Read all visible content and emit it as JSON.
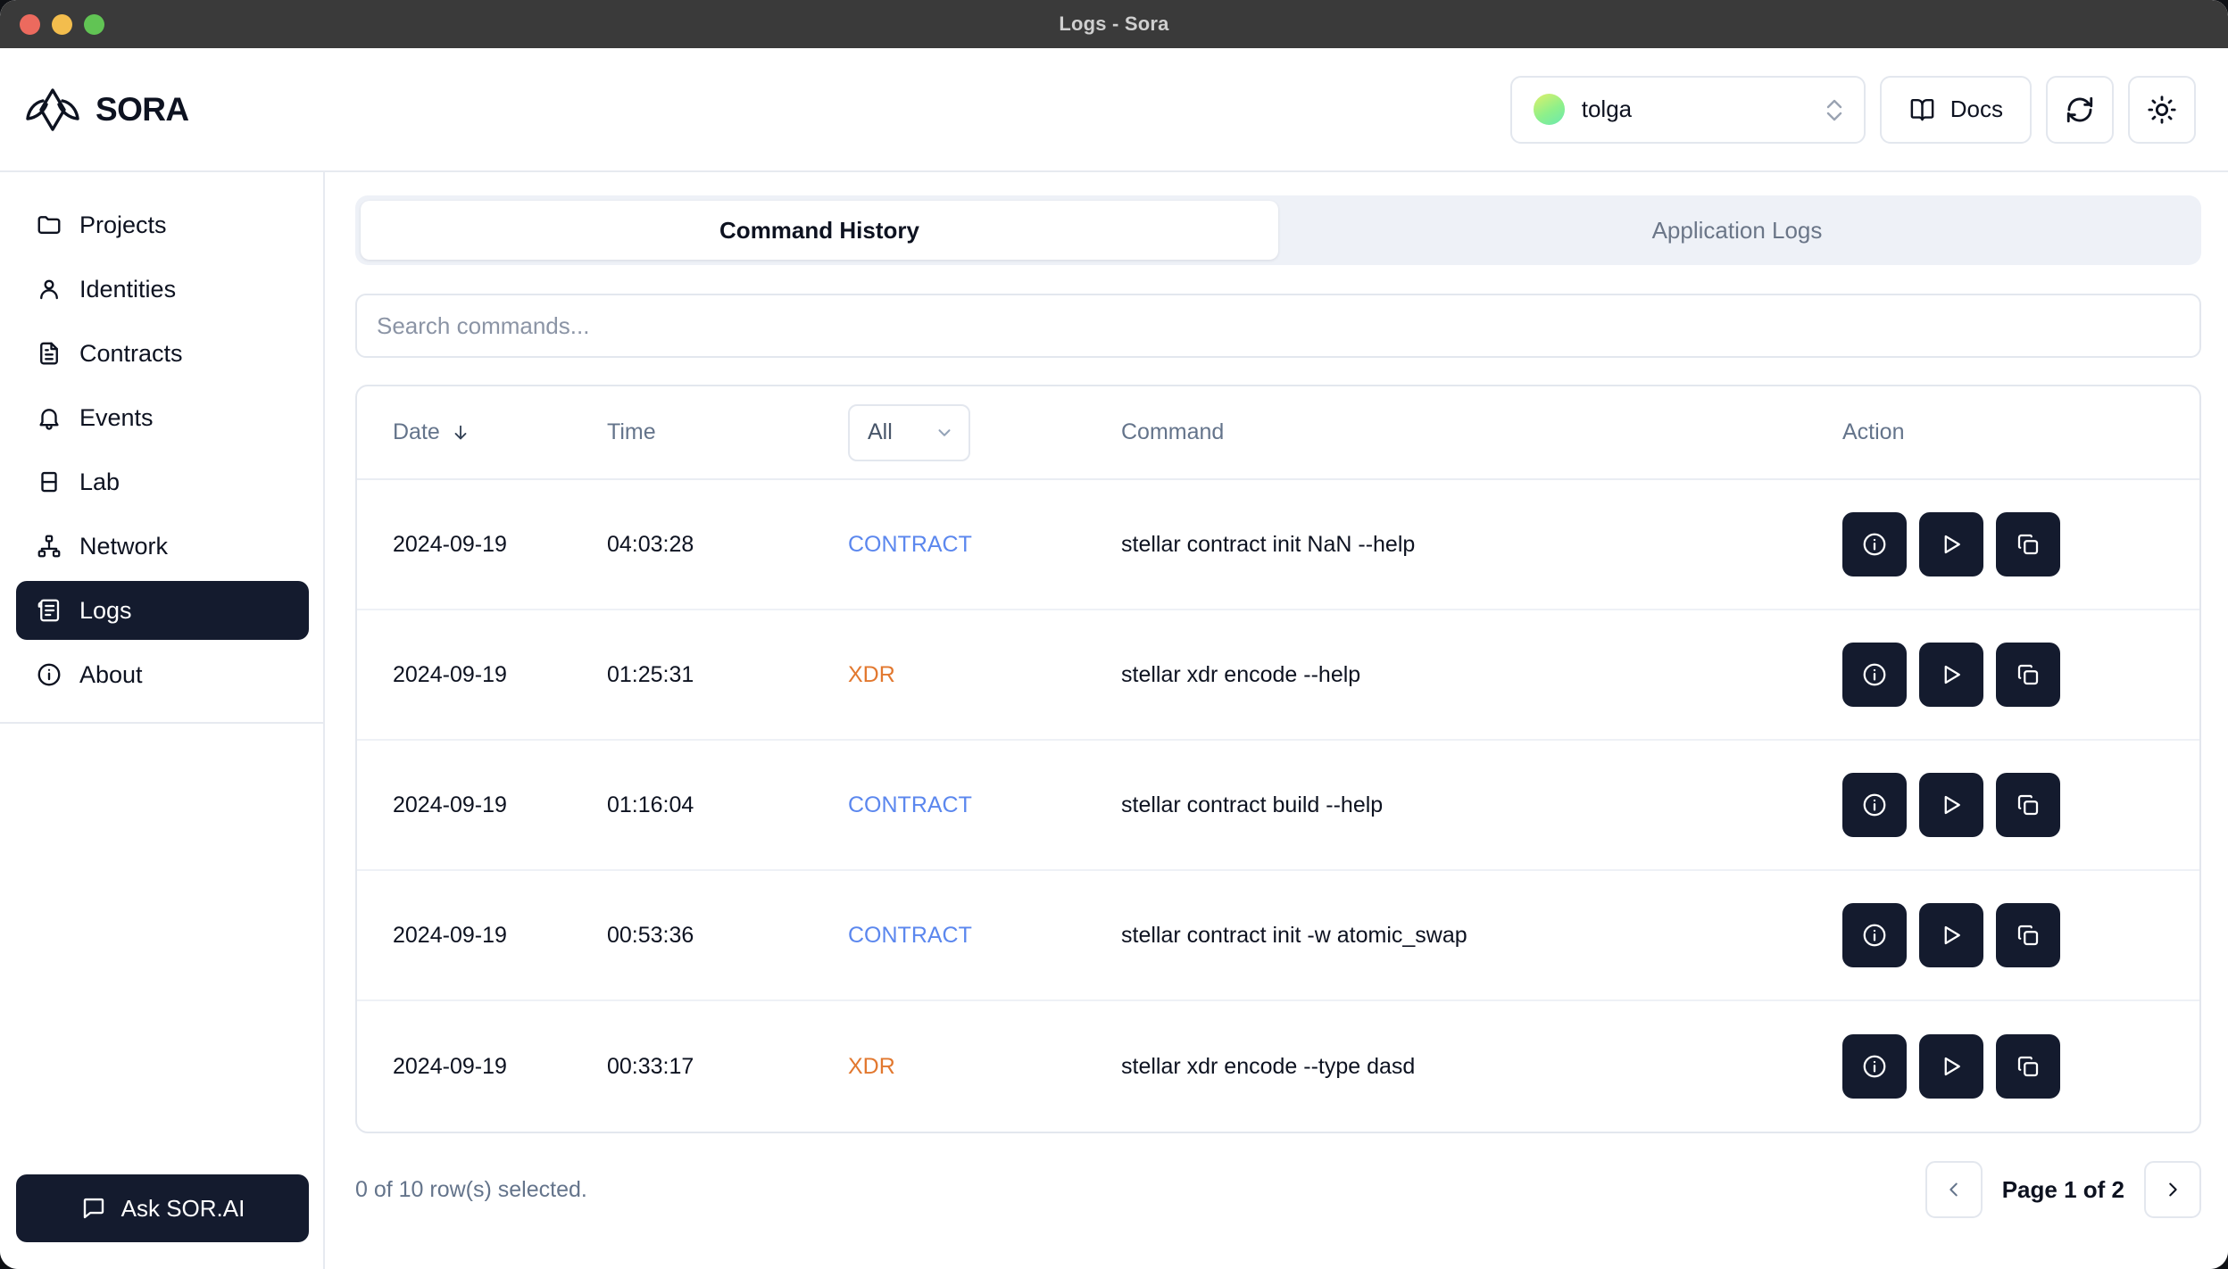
{
  "window": {
    "title": "Logs - Sora",
    "traffic_lights": [
      "close",
      "minimize",
      "zoom"
    ]
  },
  "header": {
    "brand": "SORA",
    "profile": {
      "name": "tolga",
      "icon": "avatar",
      "chevron": "chevron-up-down-icon"
    },
    "docs_label": "Docs",
    "docs_icon": "book-icon",
    "refresh_icon": "refresh-icon",
    "theme_icon": "sun-icon"
  },
  "sidebar": {
    "items": [
      {
        "label": "Projects",
        "icon": "folder-icon",
        "active": false
      },
      {
        "label": "Identities",
        "icon": "user-icon",
        "active": false
      },
      {
        "label": "Contracts",
        "icon": "document-icon",
        "active": false
      },
      {
        "label": "Events",
        "icon": "bell-icon",
        "active": false
      },
      {
        "label": "Lab",
        "icon": "beaker-icon",
        "active": false
      },
      {
        "label": "Network",
        "icon": "network-icon",
        "active": false
      },
      {
        "label": "Logs",
        "icon": "scroll-icon",
        "active": true
      },
      {
        "label": "About",
        "icon": "info-icon",
        "active": false
      }
    ],
    "ask_button": {
      "label": "Ask SOR.AI",
      "icon": "chat-icon"
    }
  },
  "main": {
    "tabs": [
      {
        "label": "Command History",
        "active": true
      },
      {
        "label": "Application Logs",
        "active": false
      }
    ],
    "search": {
      "value": "",
      "placeholder": "Search commands..."
    },
    "table": {
      "columns": {
        "date": "Date",
        "date_sort_icon": "arrow-down-icon",
        "time": "Time",
        "type_filter": {
          "value": "All",
          "icon": "chevron-down-icon"
        },
        "command": "Command",
        "action": "Action"
      },
      "rows": [
        {
          "date": "2024-09-19",
          "time": "04:03:28",
          "type": "CONTRACT",
          "type_class": "contract",
          "command": "stellar contract init NaN --help"
        },
        {
          "date": "2024-09-19",
          "time": "01:25:31",
          "type": "XDR",
          "type_class": "xdr",
          "command": "stellar xdr encode --help"
        },
        {
          "date": "2024-09-19",
          "time": "01:16:04",
          "type": "CONTRACT",
          "type_class": "contract",
          "command": "stellar contract build --help"
        },
        {
          "date": "2024-09-19",
          "time": "00:53:36",
          "type": "CONTRACT",
          "type_class": "contract",
          "command": "stellar contract init -w atomic_swap"
        },
        {
          "date": "2024-09-19",
          "time": "00:33:17",
          "type": "XDR",
          "type_class": "xdr",
          "command": "stellar xdr encode --type dasd"
        }
      ],
      "row_actions": [
        {
          "name": "details-button",
          "icon": "info-circle-icon"
        },
        {
          "name": "run-button",
          "icon": "play-icon"
        },
        {
          "name": "copy-button",
          "icon": "copy-icon"
        }
      ]
    },
    "footer": {
      "rows_selected": "0 of 10 row(s) selected.",
      "page_label": "Page 1 of 2",
      "prev_icon": "chevron-left-icon",
      "next_icon": "chevron-right-icon"
    }
  },
  "colors": {
    "contract": "#5b87ee",
    "xdr": "#e2782f",
    "active_nav": "#141b2e",
    "tab_track": "#eef1f7",
    "border": "#e3e7ee"
  }
}
